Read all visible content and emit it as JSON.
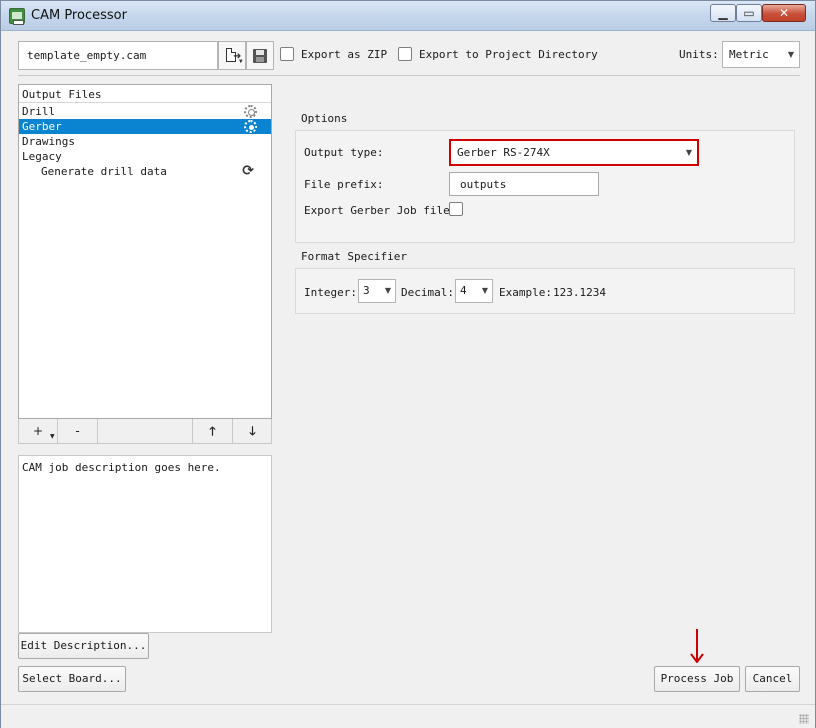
{
  "window": {
    "title": "CAM Processor",
    "controls": {
      "minimize": "▁",
      "maximize": "▭",
      "close": "✕"
    }
  },
  "toolbar": {
    "template_file": "template_empty.cam",
    "icons": {
      "new_file": "new-file-icon",
      "save": "save-icon"
    },
    "export_zip": {
      "label": "Export as ZIP",
      "checked": false
    },
    "export_project_dir": {
      "label": "Export to Project Directory",
      "checked": false
    },
    "units": {
      "label": "Units:",
      "value": "Metric"
    }
  },
  "tree": {
    "header": "Output Files",
    "items": [
      {
        "label": "Drill",
        "indent": 0,
        "selected": false,
        "icon": "gear-icon"
      },
      {
        "label": "Gerber",
        "indent": 0,
        "selected": true,
        "icon": "gear-icon"
      },
      {
        "label": "Drawings",
        "indent": 0,
        "selected": false,
        "icon": ""
      },
      {
        "label": "Legacy",
        "indent": 0,
        "selected": false,
        "icon": ""
      },
      {
        "label": "Generate drill data",
        "indent": 1,
        "selected": false,
        "icon": "refresh-icon"
      }
    ],
    "buttons": {
      "add": "+",
      "remove": "-",
      "up": "🡑",
      "down": "🡓"
    }
  },
  "description": "CAM job description goes here.",
  "options": {
    "title": "Options",
    "output_type": {
      "label": "Output type:",
      "value": "Gerber RS-274X"
    },
    "file_prefix": {
      "label": "File prefix:",
      "value": "outputs"
    },
    "export_job_file": {
      "label": "Export Gerber Job file:",
      "checked": false
    }
  },
  "format": {
    "title": "Format Specifier",
    "integer": {
      "label": "Integer:",
      "value": "3"
    },
    "decimal": {
      "label": "Decimal:",
      "value": "4"
    },
    "example": {
      "label": "Example:",
      "value": "123.1234"
    }
  },
  "buttons": {
    "edit_description": "Edit Description...",
    "select_board": "Select Board...",
    "process_job": "Process Job",
    "cancel": "Cancel"
  },
  "highlight_color": "#d10000",
  "selection_color": "#0a83d1"
}
